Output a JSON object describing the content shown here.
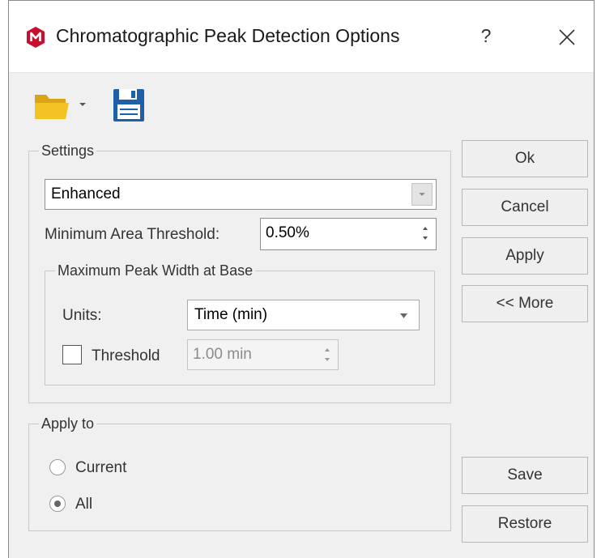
{
  "window": {
    "title": "Chromatographic Peak Detection Options",
    "help_label": "?",
    "brand_color": "#c8102e"
  },
  "toolbar": {
    "open_icon": "folder-icon",
    "save_icon": "floppy-disk-icon"
  },
  "settings": {
    "legend": "Settings",
    "mode_value": "Enhanced",
    "min_area_label": "Minimum Area Threshold:",
    "min_area_value": "0.50%",
    "max_peak": {
      "legend": "Maximum Peak Width at Base",
      "units_label": "Units:",
      "units_value": "Time (min)",
      "threshold_label": "Threshold",
      "threshold_checked": false,
      "threshold_value": "1.00 min"
    }
  },
  "apply_to": {
    "legend": "Apply to",
    "options": [
      {
        "label": "Current",
        "selected": false
      },
      {
        "label": "All",
        "selected": true
      }
    ]
  },
  "buttons": {
    "ok": "Ok",
    "cancel": "Cancel",
    "apply": "Apply",
    "more": "<< More",
    "save": "Save",
    "restore": "Restore"
  }
}
